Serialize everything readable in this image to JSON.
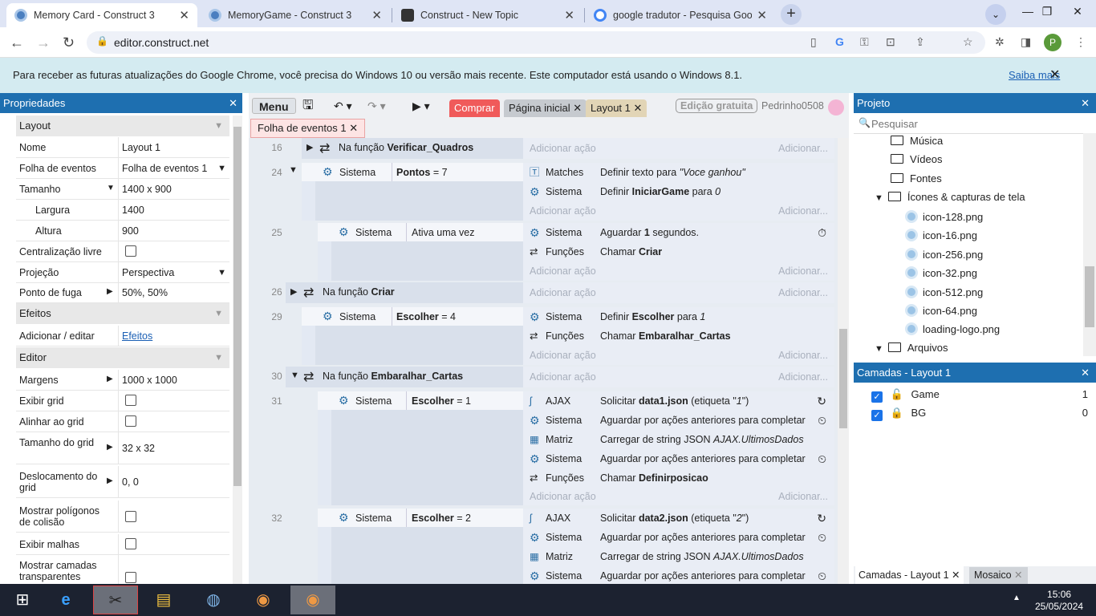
{
  "browser": {
    "tabs": [
      {
        "title": "Memory Card - Construct 3",
        "active": true
      },
      {
        "title": "MemoryGame - Construct 3",
        "active": false
      },
      {
        "title": "Construct - New Topic",
        "active": false
      },
      {
        "title": "google tradutor - Pesquisa Goog",
        "active": false
      }
    ],
    "new_tab": "+",
    "url": "editor.construct.net",
    "profile_initial": "P",
    "window_buttons": [
      "—",
      "❐",
      "✕"
    ]
  },
  "infobar": {
    "text": "Para receber as futuras atualizações do Google Chrome, você precisa do Windows 10 ou versão mais recente. Este computador está usando o Windows 8.1.",
    "link": "Saiba mais",
    "close": "✕"
  },
  "properties": {
    "title": "Propriedades",
    "close": "✕",
    "sections": {
      "layout": "Layout",
      "effects": "Efeitos",
      "editor": "Editor"
    },
    "rows": {
      "name_label": "Nome",
      "name_value": "Layout 1",
      "sheet_label": "Folha de eventos",
      "sheet_value": "Folha de eventos 1",
      "size_label": "Tamanho",
      "size_value": "1400 x 900",
      "width_label": "Largura",
      "width_value": "1400",
      "height_label": "Altura",
      "height_value": "900",
      "free_center_label": "Centralização livre",
      "projection_label": "Projeção",
      "projection_value": "Perspectiva",
      "vanish_label": "Ponto de fuga",
      "vanish_value": "50%, 50%",
      "add_edit_label": "Adicionar / editar",
      "add_edit_link": "Efeitos",
      "margins_label": "Margens",
      "margins_value": "1000 x 1000",
      "show_grid_label": "Exibir grid",
      "snap_grid_label": "Alinhar ao grid",
      "grid_size_label": "Tamanho do grid",
      "grid_size_value": "32 x 32",
      "grid_offset_label": "Deslocamento do grid",
      "grid_offset_value": "0, 0",
      "show_collision_label": "Mostrar polígonos de colisão",
      "show_meshes_label": "Exibir malhas",
      "show_transparent_label": "Mostrar camadas transparentes"
    }
  },
  "editor_toolbar": {
    "menu": "Menu",
    "buy": "Comprar",
    "home_tab": "Página inicial",
    "layout_tab": "Layout 1",
    "free_edition": "Edição gratuita",
    "user": "Pedrinho0508",
    "sheet_tab": "Folha de eventos 1"
  },
  "events": {
    "add_action": "Adicionar ação",
    "add_short": "Adicionar...",
    "e16": {
      "num": "16",
      "func_prefix": "Na função",
      "func_name": "Verificar_Quadros"
    },
    "e24": {
      "num": "24",
      "obj": "Sistema",
      "cond_var": "Pontos",
      "cond_rest": " = 7",
      "a1_obj": "Matches",
      "a1_pre": "Definir texto para ",
      "a1_val": "\"Voce ganhou\"",
      "a2_obj": "Sistema",
      "a2_pre": "Definir ",
      "a2_var": "IniciarGame",
      "a2_mid": " para ",
      "a2_val": "0"
    },
    "e25": {
      "num": "25",
      "obj": "Sistema",
      "cond": "Ativa uma vez",
      "a1_obj": "Sistema",
      "a1_pre": "Aguardar ",
      "a1_val": "1",
      "a1_post": " segundos.",
      "a2_obj": "Funções",
      "a2_pre": "Chamar ",
      "a2_val": "Criar"
    },
    "e26": {
      "num": "26",
      "func_prefix": "Na função",
      "func_name": "Criar"
    },
    "e29": {
      "num": "29",
      "obj": "Sistema",
      "cond_var": "Escolher",
      "cond_rest": " = 4",
      "a1_obj": "Sistema",
      "a1_pre": "Definir ",
      "a1_var": "Escolher",
      "a1_mid": " para ",
      "a1_val": "1",
      "a2_obj": "Funções",
      "a2_pre": "Chamar ",
      "a2_val": "Embaralhar_Cartas"
    },
    "e30": {
      "num": "30",
      "func_prefix": "Na função",
      "func_name": "Embaralhar_Cartas"
    },
    "e31": {
      "num": "31",
      "obj": "Sistema",
      "cond_var": "Escolher",
      "cond_rest": " = 1",
      "a1_obj": "AJAX",
      "a1_pre": "Solicitar ",
      "a1_val": "data1.json",
      "a1_post": " (etiqueta \"",
      "a1_tag": "1",
      "a1_end": "\")",
      "a2_obj": "Sistema",
      "a2_text": "Aguardar por ações anteriores para completar",
      "a3_obj": "Matriz",
      "a3_pre": "Carregar de string JSON ",
      "a3_val": "AJAX.UltimosDados",
      "a4_obj": "Sistema",
      "a4_text": "Aguardar por ações anteriores para completar",
      "a5_obj": "Funções",
      "a5_pre": "Chamar ",
      "a5_val": "Definirposicao"
    },
    "e32": {
      "num": "32",
      "obj": "Sistema",
      "cond_var": "Escolher",
      "cond_rest": " = 2",
      "a1_obj": "AJAX",
      "a1_pre": "Solicitar ",
      "a1_val": "data2.json",
      "a1_post": " (etiqueta \"",
      "a1_tag": "2",
      "a1_end": "\")",
      "a2_obj": "Sistema",
      "a2_text": "Aguardar por ações anteriores para completar",
      "a3_obj": "Matriz",
      "a3_pre": "Carregar de string JSON ",
      "a3_val": "AJAX.UltimosDados",
      "a4_obj": "Sistema",
      "a4_text": "Aguardar por ações anteriores para completar"
    }
  },
  "project": {
    "title": "Projeto",
    "close": "✕",
    "search_placeholder": "Pesquisar",
    "items": {
      "music": "Música",
      "videos": "Vídeos",
      "fonts": "Fontes",
      "icons_folder": "Ícones & capturas de tela",
      "f1": "icon-128.png",
      "f2": "icon-16.png",
      "f3": "icon-256.png",
      "f4": "icon-32.png",
      "f5": "icon-512.png",
      "f6": "icon-64.png",
      "f7": "loading-logo.png",
      "files": "Arquivos"
    }
  },
  "layers": {
    "title": "Camadas - Layout 1",
    "close": "✕",
    "l1_name": "Game",
    "l1_index": "1",
    "l2_name": "BG",
    "l2_index": "0",
    "tab1": "Camadas - Layout 1",
    "tab2": "Mosaico"
  },
  "taskbar": {
    "time": "15:06",
    "date": "25/05/2024"
  },
  "colors": {
    "accent": "#1e6fb0",
    "infobar": "#d4ebf1",
    "buy": "#f05a5a"
  }
}
